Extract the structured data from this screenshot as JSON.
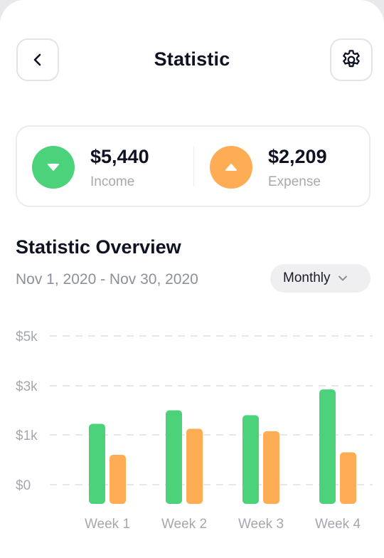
{
  "header": {
    "title": "Statistic",
    "back_icon": "chevron-left-icon",
    "settings_icon": "gear-icon"
  },
  "summary": {
    "income": {
      "amount": "$5,440",
      "label": "Income",
      "icon": "arrow-down-icon",
      "color": "#4cd27b"
    },
    "expense": {
      "amount": "$2,209",
      "label": "Expense",
      "icon": "arrow-up-icon",
      "color": "#ffad54"
    }
  },
  "overview": {
    "title": "Statistic Overview",
    "date_range": "Nov 1, 2020 - Nov 30, 2020",
    "period": {
      "selected": "Monthly",
      "icon": "chevron-down-icon"
    }
  },
  "chart_data": {
    "type": "bar",
    "categories": [
      "Week 1",
      "Week 2",
      "Week 3",
      "Week 4"
    ],
    "y_ticks": [
      {
        "label": "$0",
        "value": 0
      },
      {
        "label": "$1k",
        "value": 1000
      },
      {
        "label": "$3k",
        "value": 3000
      },
      {
        "label": "$5k",
        "value": 5000
      }
    ],
    "series": [
      {
        "name": "Income",
        "color": "#4cd27b",
        "values": [
          1450,
          2000,
          1800,
          2850
        ]
      },
      {
        "name": "Expense",
        "color": "#ffad54",
        "values": [
          600,
          1250,
          1150,
          650
        ]
      }
    ],
    "grid": "dashed horizontal",
    "ylim": [
      0,
      5000
    ]
  }
}
